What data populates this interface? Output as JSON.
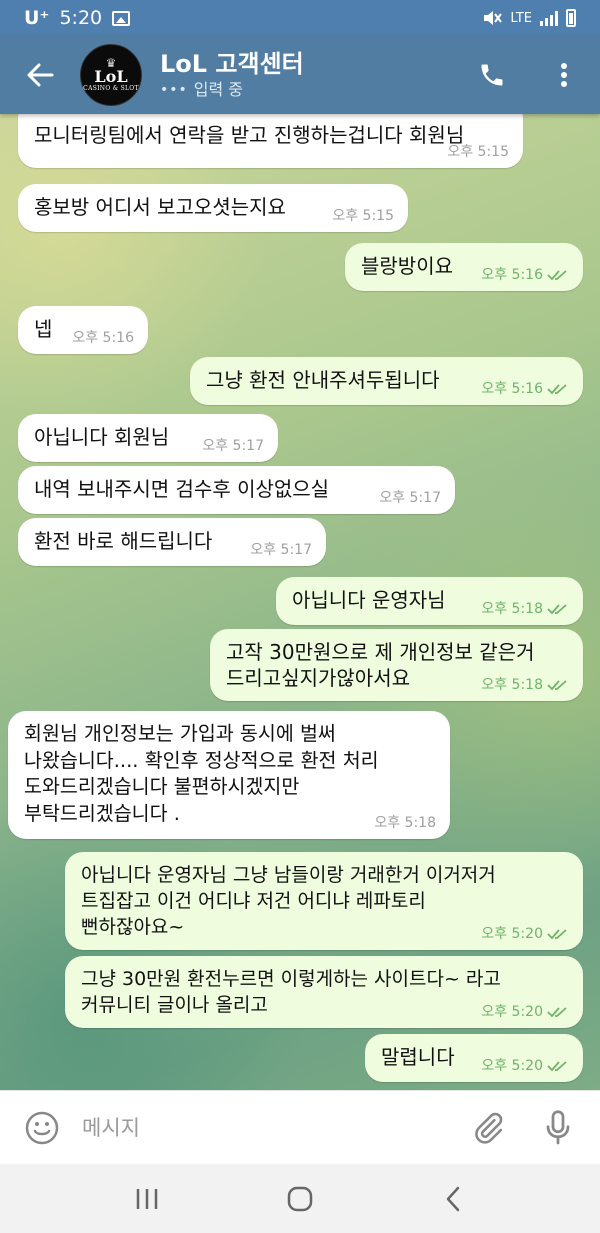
{
  "status_bar": {
    "carrier": "U⁺",
    "time": "5:20",
    "network": "LTE"
  },
  "header": {
    "title": "LoL 고객센터",
    "status": "입력 중",
    "avatar_logo": "LoL",
    "avatar_sub": "CASINO & SLOT"
  },
  "messages": [
    {
      "dir": "in",
      "text": "모니터링팀에서 연락을 받고 진행하는겁니다 회원님",
      "time": "오후 5:15"
    },
    {
      "dir": "in",
      "text": "홍보방 어디서 보고오셧는지요",
      "time": "오후 5:15"
    },
    {
      "dir": "out",
      "text": "블랑방이요",
      "time": "오후 5:16"
    },
    {
      "dir": "in",
      "text": "넵",
      "time": "오후 5:16"
    },
    {
      "dir": "out",
      "text": "그냥 환전 안내주셔두됩니다",
      "time": "오후 5:16"
    },
    {
      "dir": "in",
      "text": "아닙니다 회원님",
      "time": "오후 5:17"
    },
    {
      "dir": "in",
      "text": "내역 보내주시면 검수후 이상없으실",
      "time": "오후 5:17"
    },
    {
      "dir": "in",
      "text": "환전 바로 해드립니다",
      "time": "오후 5:17"
    },
    {
      "dir": "out",
      "text": "아닙니다 운영자님",
      "time": "오후 5:18"
    },
    {
      "dir": "out",
      "text": "고작 30만원으로 제 개인정보 같은거\n드리고싶지가않아서요",
      "time": "오후 5:18"
    },
    {
      "dir": "in",
      "text": "회원님 개인정보는 가입과 동시에 벌써\n나왔습니다.... 확인후 정상적으로 환전 처리\n도와드리겠습니다 불편하시겠지만\n부탁드리겠습니다 .",
      "time": "오후 5:18"
    },
    {
      "dir": "out",
      "text": "아닙니다 운영자님 그냥 남들이랑 거래한거 이거저거\n트집잡고 이건 어디냐 저건 어디냐 레파토리\n뻔하잖아요~",
      "time": "오후 5:20"
    },
    {
      "dir": "out",
      "text": "그냥 30만원 환전누르면 이렇게하는 사이트다~ 라고\n커뮤니티 글이나 올리고",
      "time": "오후 5:20"
    },
    {
      "dir": "out",
      "text": "말렵니다",
      "time": "오후 5:20"
    }
  ],
  "input": {
    "placeholder": "메시지"
  },
  "icons": {
    "back": "arrow-left-icon",
    "call": "phone-icon",
    "menu": "more-vertical-icon",
    "emoji": "smiley-icon",
    "attach": "paperclip-icon",
    "mic": "microphone-icon",
    "read": "double-check-icon"
  },
  "colors": {
    "header": "#517da2",
    "incoming_bubble": "#ffffff",
    "outgoing_bubble": "#effdde",
    "outgoing_time": "#6fb36a"
  }
}
